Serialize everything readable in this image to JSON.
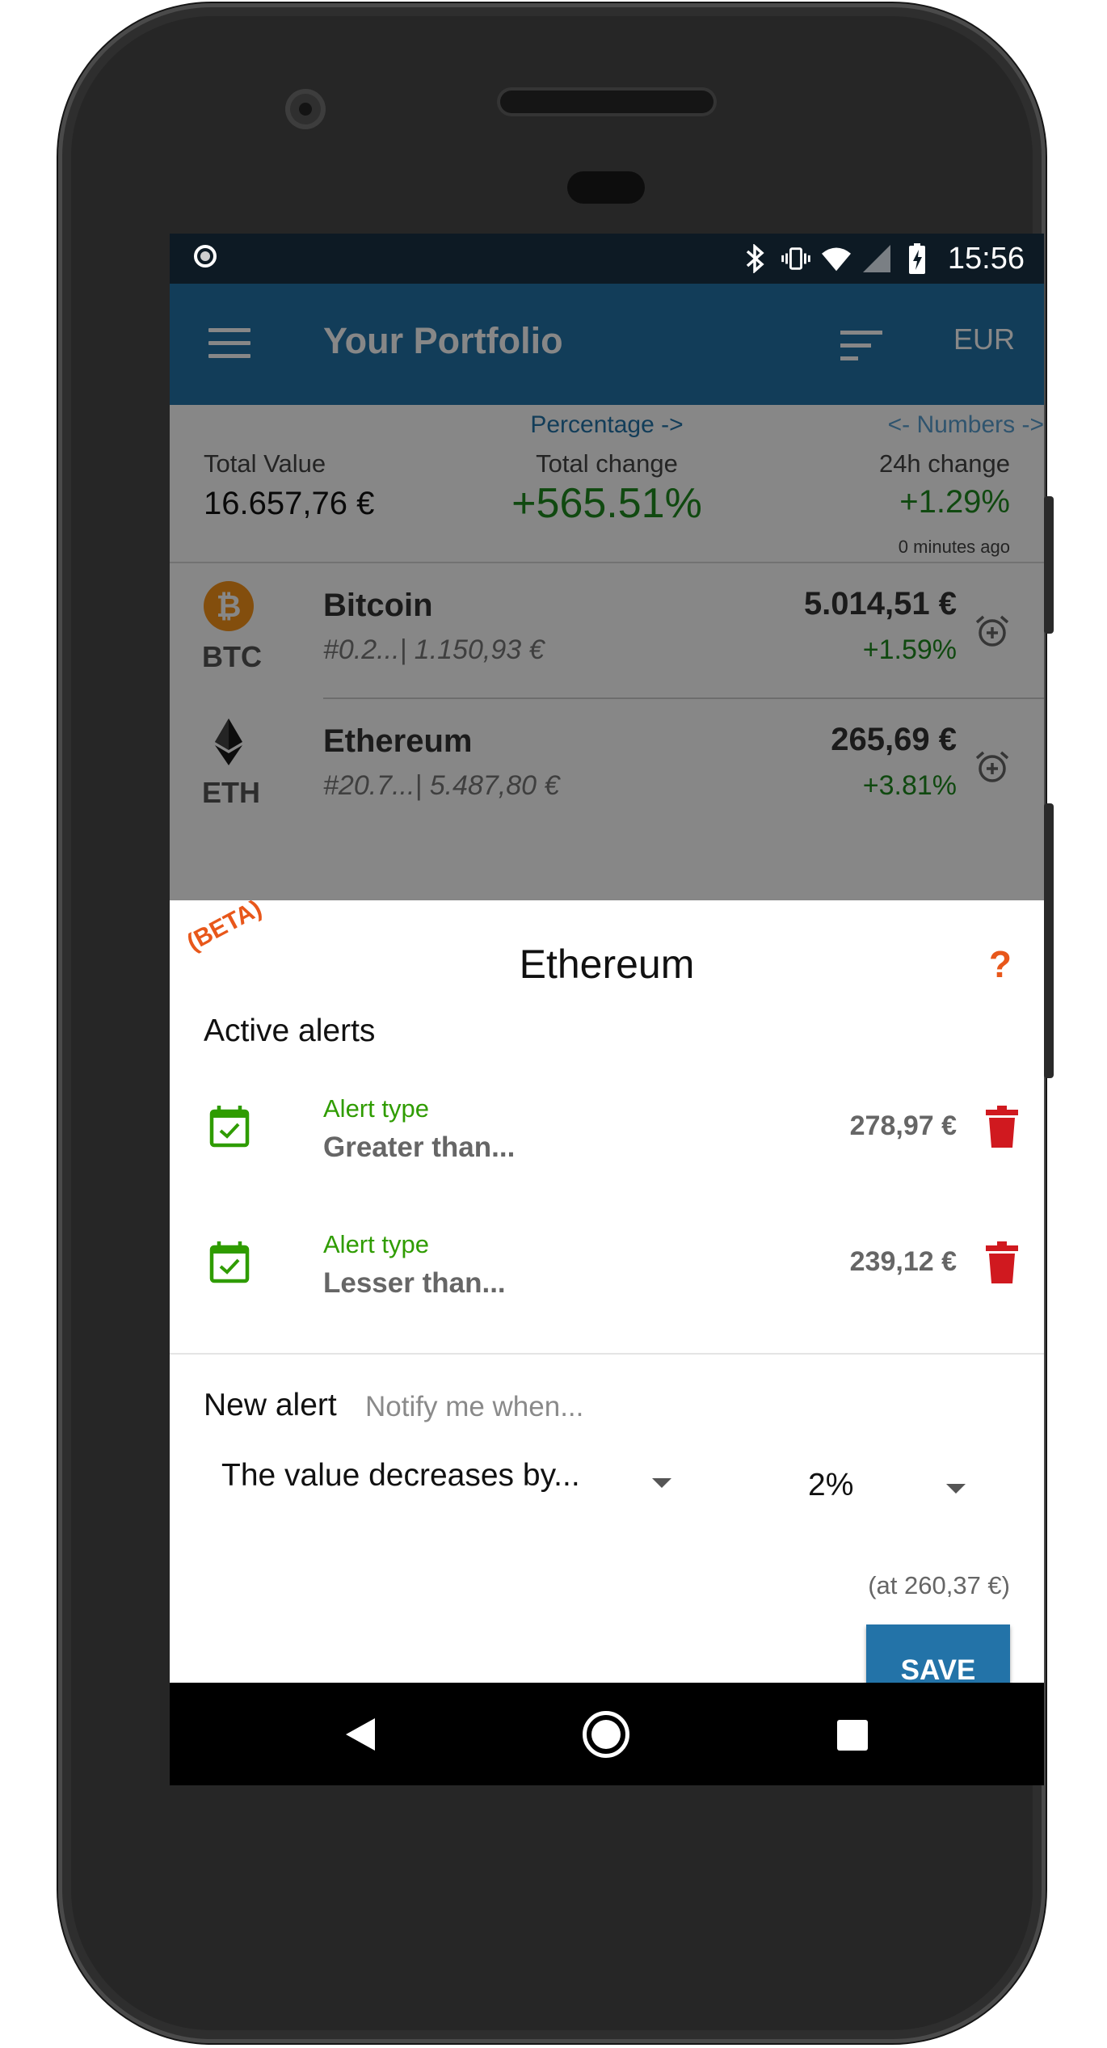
{
  "status_bar": {
    "time": "15:56",
    "icons": [
      "screen-record-icon",
      "bluetooth-icon",
      "vibrate-icon",
      "wifi-icon",
      "cell-signal-icon",
      "battery-charging-icon"
    ]
  },
  "app_bar": {
    "title": "Your Portfolio",
    "currency": "EUR",
    "icons": [
      "menu-icon",
      "sort-icon"
    ]
  },
  "summary": {
    "percentage_link": "Percentage ->",
    "numbers_link": "<- Numbers ->",
    "total_value_label": "Total Value",
    "total_value": "16.657,76 €",
    "total_change_label": "Total change",
    "total_change": "+565.51%",
    "change_24h_label": "24h change",
    "change_24h": "+1.29%",
    "updated": "0 minutes ago"
  },
  "coins": [
    {
      "name": "Bitcoin",
      "symbol": "BTC",
      "holdings": "#0.2...| 1.150,93 €",
      "price": "5.014,51 €",
      "change": "+1.59%",
      "icon": "bitcoin-icon"
    },
    {
      "name": "Ethereum",
      "symbol": "ETH",
      "holdings": "#20.7...| 5.487,80 €",
      "price": "265,69 €",
      "change": "+3.81%",
      "icon": "ethereum-icon"
    }
  ],
  "alert_sheet": {
    "beta_label": "(BETA)",
    "title": "Ethereum",
    "help": "?",
    "active_heading": "Active alerts",
    "alerts": [
      {
        "type_label": "Alert type",
        "condition": "Greater than...",
        "value": "278,97 €"
      },
      {
        "type_label": "Alert type",
        "condition": "Lesser than...",
        "value": "239,12 €"
      }
    ],
    "new_alert_heading": "New alert",
    "notify_placeholder": "Notify me when...",
    "condition_select": "The value decreases by...",
    "percent_select": "2%",
    "at_value": "(at 260,37 €)",
    "save_label": "SAVE"
  },
  "colors": {
    "primary": "#2373a8",
    "positive": "#1f8a1f",
    "alert_type": "#2f9c00",
    "accent": "#e8571a",
    "delete": "#d0191f"
  }
}
